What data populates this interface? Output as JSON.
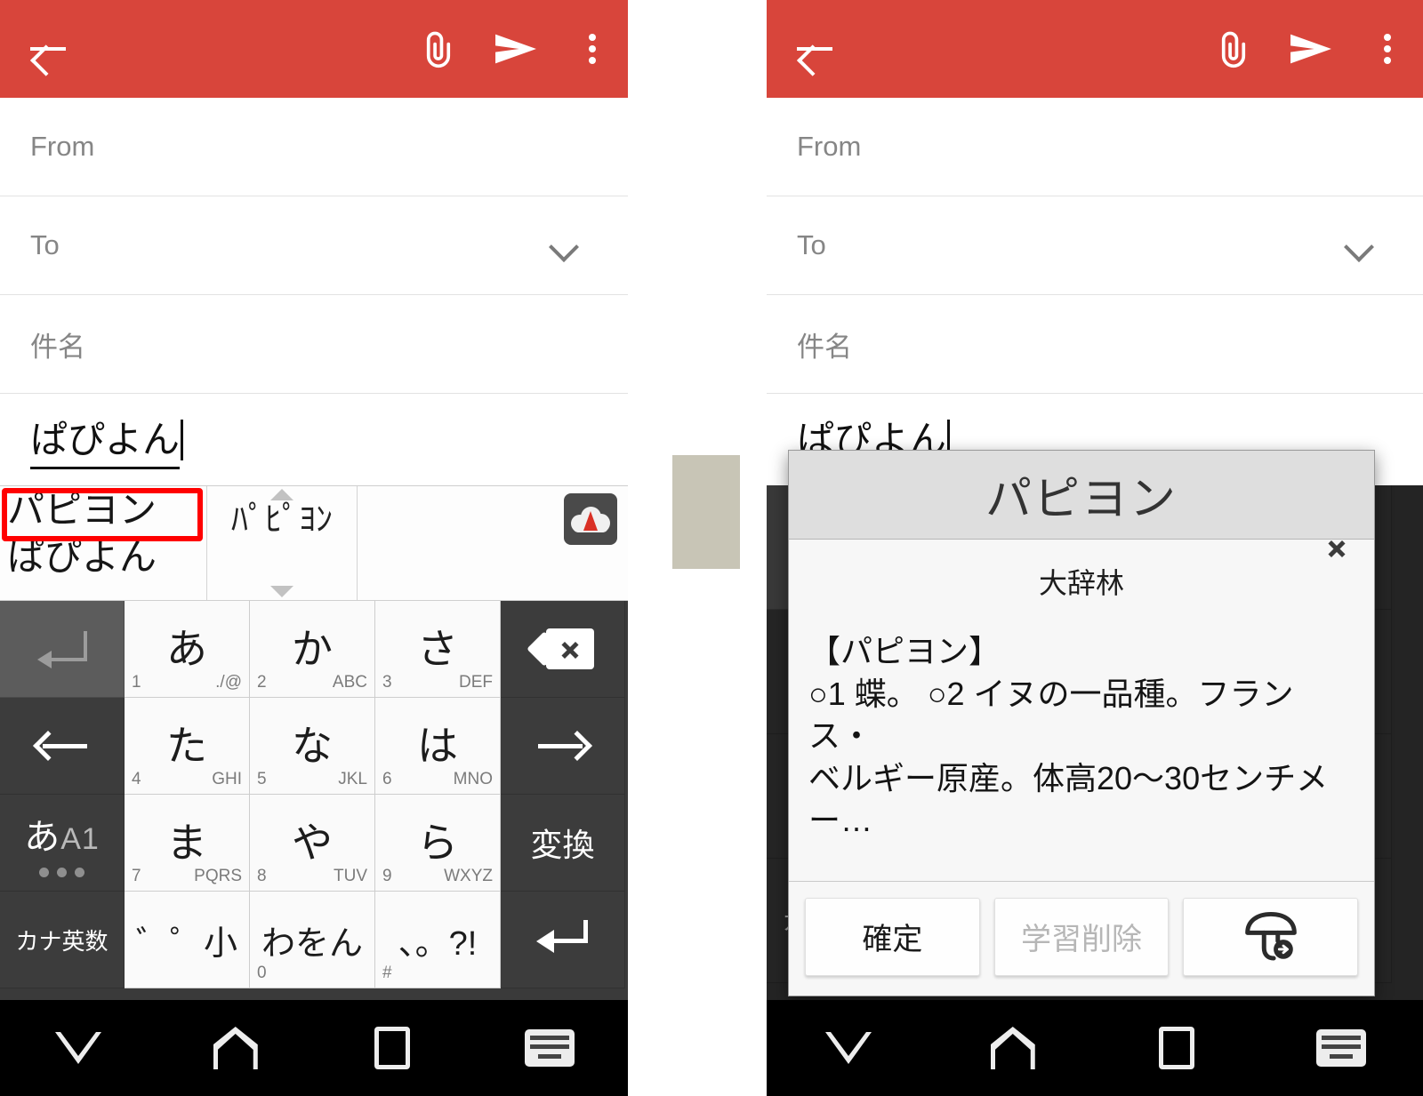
{
  "theme": {
    "appbar_red": "#D8453B",
    "highlight_red": "#FF0000",
    "key_dark": "#3c3c3c",
    "key_light": "#fafafa",
    "gap_rect_color": "#C8C5B6"
  },
  "appbar": {
    "back_icon": "arrow-left-icon",
    "attach_icon": "paperclip-icon",
    "send_icon": "send-icon",
    "overflow_icon": "more-vert-icon"
  },
  "compose": {
    "from_label": "From",
    "to_label": "To",
    "subject_placeholder": "件名",
    "body_text": "ぱぴよん"
  },
  "candidates": {
    "selected": "パピヨン",
    "second": "ぱぴよん",
    "halfwidth": "ﾊﾟﾋﾟﾖﾝ",
    "cloud_icon": "cloud-suggestion-icon",
    "scroll_up_icon": "triangle-up-icon",
    "scroll_down_icon": "triangle-down-icon"
  },
  "keyboard": {
    "rows": [
      [
        {
          "type": "fn-dim",
          "name": "undo-key",
          "icon": "undo-icon",
          "label": ""
        },
        {
          "type": "ch",
          "name": "key-a",
          "label": "あ",
          "num": "1",
          "alpha": "./@"
        },
        {
          "type": "ch",
          "name": "key-ka",
          "label": "か",
          "num": "2",
          "alpha": "ABC"
        },
        {
          "type": "ch",
          "name": "key-sa",
          "label": "さ",
          "num": "3",
          "alpha": "DEF"
        },
        {
          "type": "fn",
          "name": "backspace-key",
          "icon": "backspace-icon",
          "label": ""
        }
      ],
      [
        {
          "type": "fn",
          "name": "cursor-left-key",
          "icon": "arrow-left-icon",
          "label": ""
        },
        {
          "type": "ch",
          "name": "key-ta",
          "label": "た",
          "num": "4",
          "alpha": "GHI"
        },
        {
          "type": "ch",
          "name": "key-na",
          "label": "な",
          "num": "5",
          "alpha": "JKL"
        },
        {
          "type": "ch",
          "name": "key-ha",
          "label": "は",
          "num": "6",
          "alpha": "MNO"
        },
        {
          "type": "fn",
          "name": "cursor-right-key",
          "icon": "arrow-right-icon",
          "label": ""
        }
      ],
      [
        {
          "type": "fn",
          "name": "input-mode-key",
          "icon": "mode-switch-icon",
          "label": "あA1"
        },
        {
          "type": "ch",
          "name": "key-ma",
          "label": "ま",
          "num": "7",
          "alpha": "PQRS"
        },
        {
          "type": "ch",
          "name": "key-ya",
          "label": "や",
          "num": "8",
          "alpha": "TUV"
        },
        {
          "type": "ch",
          "name": "key-ra",
          "label": "ら",
          "num": "9",
          "alpha": "WXYZ"
        },
        {
          "type": "fn",
          "name": "convert-key",
          "label": "変換"
        }
      ],
      [
        {
          "type": "fn",
          "name": "kana-alnum-key",
          "label": "カナ英数"
        },
        {
          "type": "ch",
          "name": "key-dakuten",
          "label": "゛゜小",
          "num": "",
          "alpha": ""
        },
        {
          "type": "ch",
          "name": "key-wa",
          "label": "わをん",
          "num": "0",
          "alpha": ""
        },
        {
          "type": "ch",
          "name": "key-punct",
          "label": "、。?!",
          "num": "#",
          "alpha": ""
        },
        {
          "type": "fn",
          "name": "enter-key",
          "icon": "enter-icon",
          "label": ""
        }
      ]
    ],
    "mode_key_primary": "あ",
    "mode_key_secondary": "A1"
  },
  "navbar": {
    "back_icon": "collapse-keyboard-icon",
    "home_icon": "home-icon",
    "recents_icon": "recents-square-icon",
    "ime_switch_icon": "keyboard-switch-icon"
  },
  "dictionary_dialog": {
    "title": "パピヨン",
    "source": "大辞林",
    "entry_headword": "【パピヨン】",
    "definition_line1": "○1 蝶。 ○2 イヌの一品種。フランス・",
    "definition_line2": "ベルギー原産。体高20〜30センチメー…",
    "buttons": [
      {
        "name": "confirm-button",
        "label": "確定",
        "disabled": false
      },
      {
        "name": "delete-learning-button",
        "label": "学習削除",
        "disabled": true
      },
      {
        "name": "mushroom-button",
        "label": "",
        "icon": "mushroom-icon",
        "disabled": false
      }
    ]
  },
  "right_keyboard_visible": {
    "zero_label": "0",
    "hash_label": "#"
  }
}
